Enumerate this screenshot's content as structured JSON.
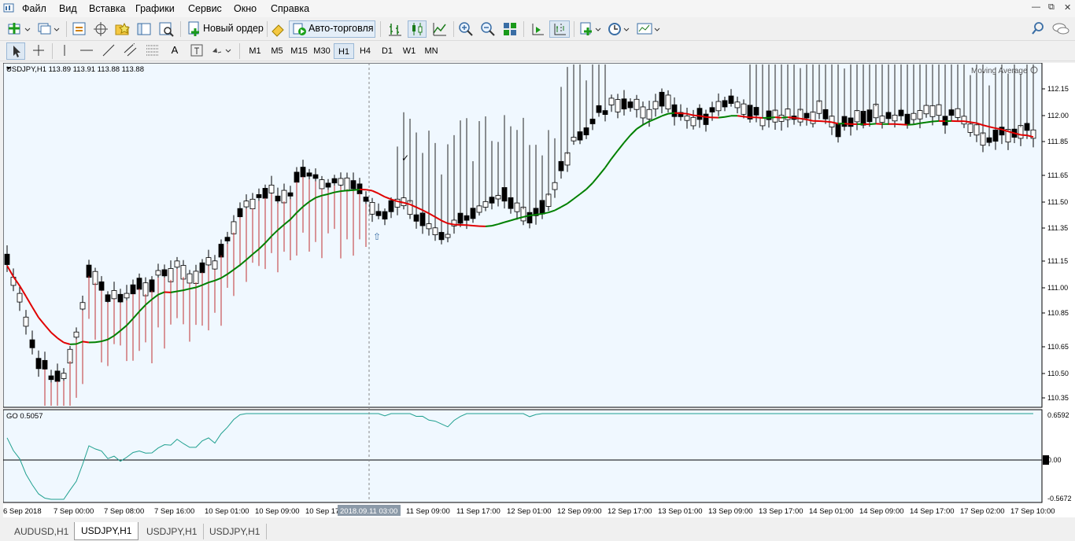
{
  "menu": [
    "Файл",
    "Вид",
    "Вставка",
    "Графики",
    "Сервис",
    "Окно",
    "Справка"
  ],
  "toolbar": {
    "new_order": "Новый ордер",
    "auto_trading": "Авто-торговля"
  },
  "timeframes": [
    "M1",
    "M5",
    "M15",
    "M30",
    "H1",
    "H4",
    "D1",
    "W1",
    "MN"
  ],
  "active_timeframe": "H1",
  "chart": {
    "symbol_header": "USDJPY,H1  113.89 113.91 113.88 113.88",
    "indicator_label": "Moving Average",
    "sub_label": "GO 0.5057",
    "cursor_time": "2018.09.11 03:00",
    "price_ticks": [
      "112.15",
      "112.00",
      "111.85",
      "111.65",
      "111.50",
      "111.35",
      "111.15",
      "111.00",
      "110.85",
      "110.65",
      "110.50",
      "110.35"
    ],
    "sub_ticks": [
      "0.6592",
      "0.00",
      "-0.5672"
    ],
    "time_labels": [
      "6 Sep 2018",
      "7 Sep 00:00",
      "7 Sep 08:00",
      "7 Sep 16:00",
      "10 Sep 01:00",
      "10 Sep 09:00",
      "10 Sep 17",
      "11 Sep 09:00",
      "11 Sep 17:00",
      "12 Sep 01:00",
      "12 Sep 09:00",
      "12 Sep 17:00",
      "13 Sep 01:00",
      "13 Sep 09:00",
      "13 Sep 17:00",
      "14 Sep 01:00",
      "14 Sep 09:00",
      "14 Sep 17:00",
      "17 Sep 02:00",
      "17 Sep 10:00"
    ]
  },
  "tabs": [
    "AUDUSD,H1",
    "USDJPY,H1",
    "USDJPY,H1",
    "USDJPY,H1"
  ],
  "active_tab": 1,
  "colors": {
    "bg": "#f0f8ff",
    "ma_up": "#008000",
    "ma_down": "#e00000",
    "osc": "#20a090"
  }
}
